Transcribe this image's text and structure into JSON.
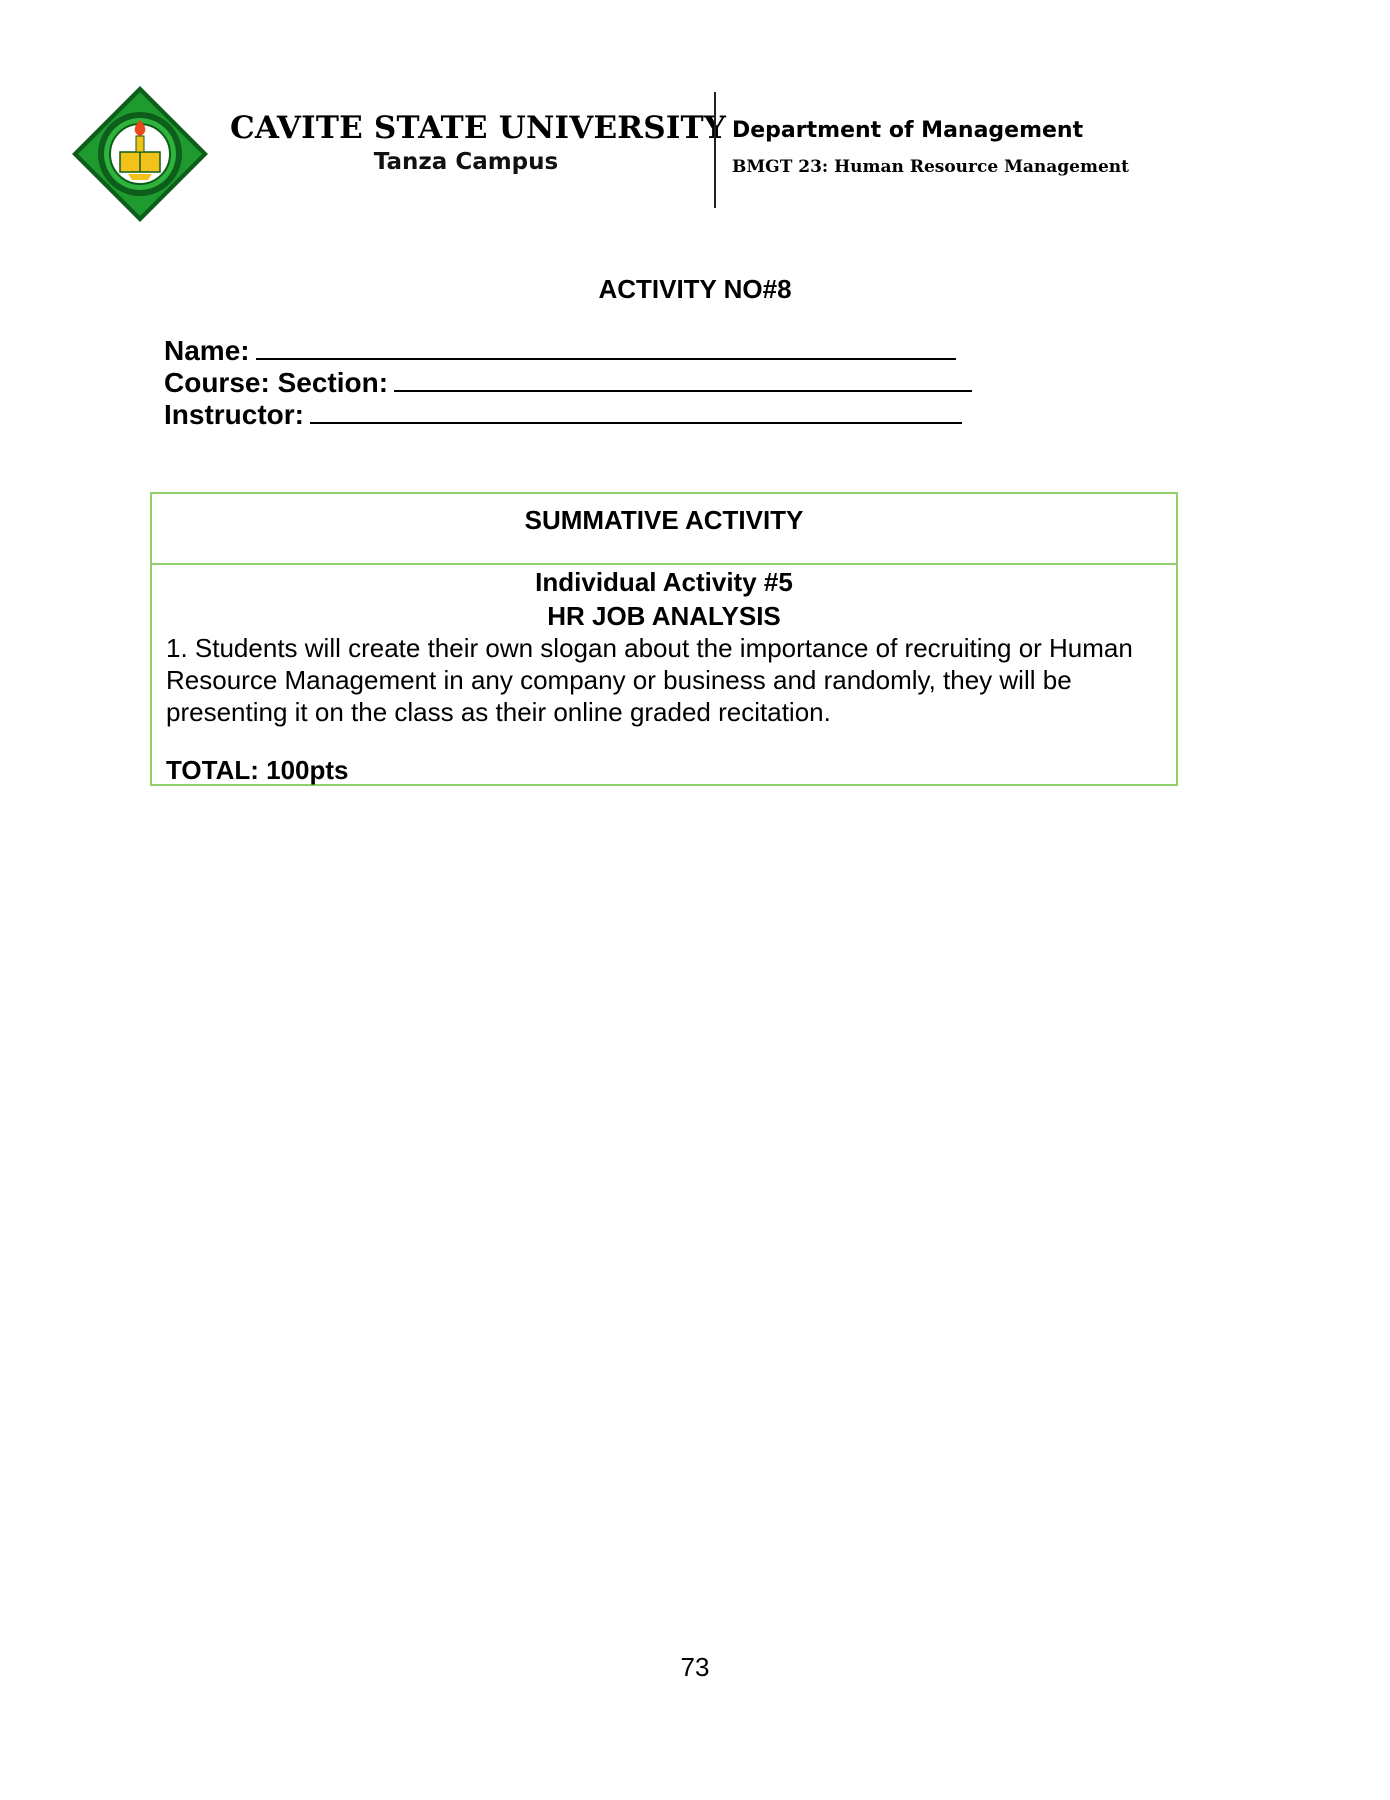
{
  "header": {
    "university": "CAVITE STATE UNIVERSITY",
    "campus": "Tanza Campus",
    "department": "Department of Management",
    "course": "BMGT 23: Human Resource Management",
    "logo_icon": "university-seal-icon",
    "logo_colors": {
      "green": "#1f9a2f",
      "dark_green": "#0c5e1a",
      "gold": "#f2c21a"
    }
  },
  "activity_title": "ACTIVITY NO#8",
  "fields": {
    "name_label": "Name:",
    "course_section_label": "Course: Section:",
    "instructor_label": "Instructor:"
  },
  "summative": {
    "title": "SUMMATIVE ACTIVITY",
    "subtitle": "Individual Activity #5",
    "topic": "HR JOB ANALYSIS",
    "instruction": "1. Students will create their own slogan about the importance of recruiting or Human Resource Management in any company or business and randomly, they will be presenting it on the class as their online graded recitation.",
    "total": "TOTAL: 100pts",
    "border_color": "#8fd16a"
  },
  "page_number": "73"
}
